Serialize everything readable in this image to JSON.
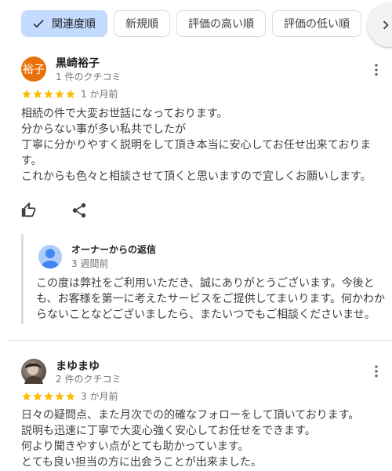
{
  "sort_chips": [
    {
      "label": "関連度順",
      "active": true
    },
    {
      "label": "新規順",
      "active": false
    },
    {
      "label": "評価の高い順",
      "active": false
    },
    {
      "label": "評価の低い順",
      "active": false
    }
  ],
  "reviews": [
    {
      "avatar_text": "裕子",
      "avatar_color": "#e8710a",
      "name": "黒崎裕子",
      "review_count": "1 件のクチコミ",
      "rating": 5,
      "date": "1 か月前",
      "text": "相続の件で大変お世話になっております。\n分からない事が多い私共でしたが\n丁寧に分かりやすく説明をして頂き本当に安心してお任せ出来ておりま\nす。\nこれからも色々と相談させて頂くと思いますので宜しくお願いします。",
      "owner_reply": {
        "title": "オーナーからの返信",
        "time": "3 週間前",
        "text": "この度は弊社をご利用いただき、誠にありがとうございます。今後とも、お客様を第一に考えたサービスをご提供してまいります。何かわからないことなどございましたら、またいつでもご相談くださいませ。"
      }
    },
    {
      "name": "まゆまゆ",
      "review_count": "2 件のクチコミ",
      "rating": 5,
      "date": "3 か月前",
      "text": "日々の疑問点、また月次での的確なフォローをして頂いております。\n説明も迅速に丁寧で大変心強く安心してお任せをできます。\n何より聞きやすい点がとても助かっています。\nとても良い担当の方に出会うことが出来ました。"
    }
  ],
  "colors": {
    "star": "#fbbc04",
    "chip_active": "#c2dbff",
    "muted": "#70757a"
  }
}
